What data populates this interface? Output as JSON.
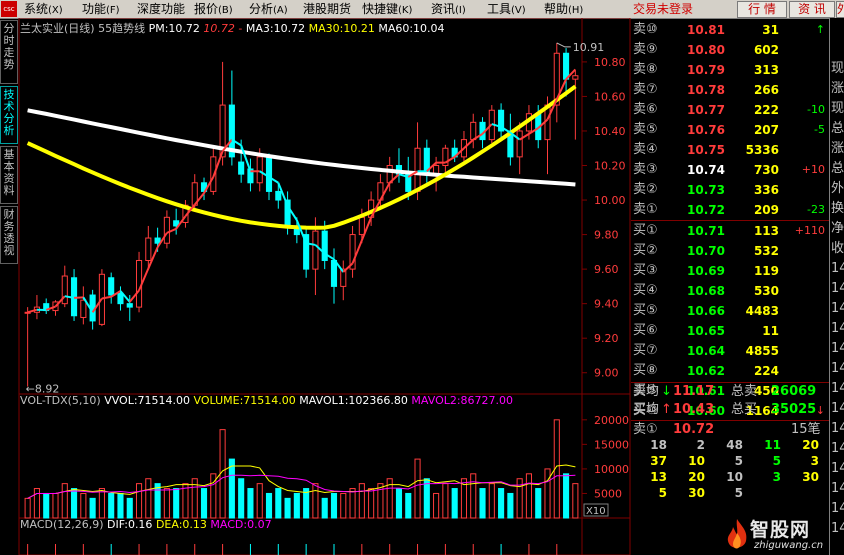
{
  "menu": {
    "items": [
      {
        "label": "系统",
        "key": "(X)"
      },
      {
        "label": "功能",
        "key": "(F)"
      },
      {
        "label": "深度功能",
        "key": ""
      },
      {
        "label": "报价",
        "key": "(B)"
      },
      {
        "label": "分析",
        "key": "(A)"
      },
      {
        "label": "港股期货",
        "key": ""
      },
      {
        "label": "快捷键",
        "key": "(K)"
      },
      {
        "label": "资讯",
        "key": "(I)"
      },
      {
        "label": "工具",
        "key": "(V)"
      },
      {
        "label": "帮助",
        "key": "(H)"
      }
    ],
    "logo": "csc",
    "login_status": "交易未登录",
    "btn_quote": "行 情",
    "btn_news": "资 讯",
    "btn_foreign": "外"
  },
  "side_tabs": [
    "分时走势",
    "技术分析",
    "基本资料",
    "财务透视"
  ],
  "price_header": {
    "title": "兰太实业(日线) 55趋势线",
    "pm_label": "PM:10.72",
    "pm_value": "10.72",
    "pm_dash": "-",
    "ma3": "MA3:10.72",
    "ma30": "MA30:10.21",
    "ma60": "MA60:10.04"
  },
  "price_axis": {
    "labels": [
      "10.80",
      "10.60",
      "10.40",
      "10.20",
      "10.00",
      "9.80",
      "9.60",
      "9.40",
      "9.20",
      "9.00"
    ],
    "high_marker": "10.91",
    "low_marker": "8.92"
  },
  "volume_header": {
    "name": "VOL-TDX(5,10)",
    "vvol": "VVOL:71514.00",
    "volume": "VOLUME:71514.00",
    "mavol1": "MAVOL1:102366.80",
    "mavol2": "MAVOL2:86727.00"
  },
  "volume_axis": {
    "labels": [
      "20000",
      "15000",
      "10000",
      "5000"
    ],
    "unit": "X10"
  },
  "macd_header": {
    "name": "MACD(12,26,9)",
    "dif": "DIF:0.16",
    "dea": "DEA:0.13",
    "macd": "MACD:0.07"
  },
  "order_book": {
    "asks": [
      {
        "label": "卖⑩",
        "price": "10.81",
        "vol": "31",
        "chg": "↑",
        "price_color": "#ff3c3c",
        "chg_color": "#00ff00"
      },
      {
        "label": "卖⑨",
        "price": "10.80",
        "vol": "602",
        "chg": "",
        "price_color": "#ff3c3c",
        "chg_color": "#c0c0c0"
      },
      {
        "label": "卖⑧",
        "price": "10.79",
        "vol": "313",
        "chg": "",
        "price_color": "#ff3c3c",
        "chg_color": "#c0c0c0"
      },
      {
        "label": "卖⑦",
        "price": "10.78",
        "vol": "266",
        "chg": "",
        "price_color": "#ff3c3c",
        "chg_color": "#c0c0c0"
      },
      {
        "label": "卖⑥",
        "price": "10.77",
        "vol": "222",
        "chg": "-10",
        "price_color": "#ff3c3c",
        "chg_color": "#00ff00"
      },
      {
        "label": "卖⑤",
        "price": "10.76",
        "vol": "207",
        "chg": "-5",
        "price_color": "#ff3c3c",
        "chg_color": "#00ff00"
      },
      {
        "label": "卖④",
        "price": "10.75",
        "vol": "5336",
        "chg": "",
        "price_color": "#ff3c3c",
        "chg_color": "#c0c0c0"
      },
      {
        "label": "卖③",
        "price": "10.74",
        "vol": "730",
        "chg": "+10",
        "price_color": "#ffffff",
        "chg_color": "#ff3c3c"
      },
      {
        "label": "卖②",
        "price": "10.73",
        "vol": "336",
        "chg": "",
        "price_color": "#00ff00",
        "chg_color": "#c0c0c0"
      },
      {
        "label": "卖①",
        "price": "10.72",
        "vol": "209",
        "chg": "-23",
        "price_color": "#00ff00",
        "chg_color": "#00ff00"
      }
    ],
    "bids": [
      {
        "label": "买①",
        "price": "10.71",
        "vol": "113",
        "chg": "+110",
        "price_color": "#00ff00",
        "chg_color": "#ff3c3c"
      },
      {
        "label": "买②",
        "price": "10.70",
        "vol": "532",
        "chg": "",
        "price_color": "#00ff00",
        "chg_color": "#c0c0c0"
      },
      {
        "label": "买③",
        "price": "10.69",
        "vol": "119",
        "chg": "",
        "price_color": "#00ff00",
        "chg_color": "#c0c0c0"
      },
      {
        "label": "买④",
        "price": "10.68",
        "vol": "530",
        "chg": "",
        "price_color": "#00ff00",
        "chg_color": "#c0c0c0"
      },
      {
        "label": "买⑤",
        "price": "10.66",
        "vol": "4483",
        "chg": "",
        "price_color": "#00ff00",
        "chg_color": "#c0c0c0"
      },
      {
        "label": "买⑥",
        "price": "10.65",
        "vol": "11",
        "chg": "",
        "price_color": "#00ff00",
        "chg_color": "#c0c0c0"
      },
      {
        "label": "买⑦",
        "price": "10.64",
        "vol": "4855",
        "chg": "",
        "price_color": "#00ff00",
        "chg_color": "#c0c0c0"
      },
      {
        "label": "买⑧",
        "price": "10.62",
        "vol": "224",
        "chg": "",
        "price_color": "#00ff00",
        "chg_color": "#c0c0c0"
      },
      {
        "label": "买⑨",
        "price": "10.61",
        "vol": "450",
        "chg": "",
        "price_color": "#00ff00",
        "chg_color": "#c0c0c0"
      },
      {
        "label": "买⑩",
        "price": "10.60",
        "vol": "1164",
        "chg": "↓",
        "price_color": "#00ff00",
        "chg_color": "#ff3c3c"
      }
    ],
    "avg_sell": {
      "label": "卖均",
      "arrow": "↓",
      "price": "11.17",
      "total_label": "总卖",
      "total": "26069"
    },
    "avg_buy": {
      "label": "买均",
      "arrow": "↑",
      "price": "10.43",
      "total_label": "总买",
      "total": "35025"
    },
    "queue": {
      "label": "卖①",
      "price": "10.72",
      "count": "15笔"
    },
    "queue_rows": [
      [
        "18",
        "2",
        "48",
        "11",
        "20"
      ],
      [
        "37",
        "10",
        "5",
        "5",
        "3"
      ],
      [
        "13",
        "20",
        "10",
        "3",
        "30"
      ],
      [
        "5",
        "30",
        "5",
        "",
        ""
      ]
    ]
  },
  "right_panel": {
    "chars": [
      "现",
      "涨",
      "现",
      "总",
      "涨",
      "总",
      "外",
      "换",
      "净",
      "收",
      "14",
      "14",
      "14",
      "14",
      "14",
      "14",
      "14",
      "14",
      "14",
      "14",
      "14",
      "14",
      "14",
      "14"
    ]
  },
  "watermark": {
    "brand": "智股网",
    "site": "zhiguwang.cn"
  },
  "colors": {
    "up": "#ff3c3c",
    "down": "#00ffff",
    "ma_white": "#ffffff",
    "ma_yellow": "#ffff00",
    "pm_red": "#ff3c3c",
    "grid": "#800000",
    "axis_text": "#ff3c3c",
    "vol_avg1": "#ffff00",
    "vol_avg2": "#ff00ff"
  },
  "chart_data": [
    {
      "type": "candlestick",
      "title": "兰太实业(日线) 55趋势线",
      "ylim": [
        8.9,
        10.95
      ],
      "candles": [
        [
          9.35,
          9.38,
          8.92,
          9.35
        ],
        [
          9.35,
          9.45,
          9.31,
          9.38
        ],
        [
          9.4,
          9.43,
          9.34,
          9.36
        ],
        [
          9.36,
          9.42,
          9.33,
          9.41
        ],
        [
          9.4,
          9.62,
          9.38,
          9.56
        ],
        [
          9.55,
          9.6,
          9.3,
          9.33
        ],
        [
          9.32,
          9.5,
          9.28,
          9.42
        ],
        [
          9.45,
          9.48,
          9.25,
          9.3
        ],
        [
          9.28,
          9.6,
          9.27,
          9.57
        ],
        [
          9.55,
          9.58,
          9.4,
          9.45
        ],
        [
          9.46,
          9.5,
          9.36,
          9.4
        ],
        [
          9.4,
          9.45,
          9.3,
          9.38
        ],
        [
          9.38,
          9.7,
          9.35,
          9.65
        ],
        [
          9.65,
          9.85,
          9.6,
          9.78
        ],
        [
          9.78,
          9.84,
          9.7,
          9.75
        ],
        [
          9.75,
          9.94,
          9.72,
          9.9
        ],
        [
          9.88,
          9.95,
          9.8,
          9.85
        ],
        [
          9.87,
          10.0,
          9.84,
          9.97
        ],
        [
          9.97,
          10.15,
          9.94,
          10.1
        ],
        [
          10.1,
          10.13,
          10.0,
          10.05
        ],
        [
          10.05,
          10.3,
          10.03,
          10.25
        ],
        [
          10.25,
          10.8,
          10.2,
          10.55
        ],
        [
          10.55,
          10.75,
          10.2,
          10.25
        ],
        [
          10.22,
          10.35,
          10.1,
          10.15
        ],
        [
          10.18,
          10.24,
          10.05,
          10.1
        ],
        [
          10.1,
          10.3,
          10.05,
          10.25
        ],
        [
          10.25,
          10.27,
          10.0,
          10.05
        ],
        [
          10.05,
          10.1,
          9.95,
          10.0
        ],
        [
          10.0,
          10.05,
          9.8,
          9.85
        ],
        [
          9.85,
          9.9,
          9.75,
          9.8
        ],
        [
          9.8,
          9.85,
          9.55,
          9.6
        ],
        [
          9.6,
          9.9,
          9.45,
          9.82
        ],
        [
          9.82,
          9.88,
          9.6,
          9.65
        ],
        [
          9.65,
          9.72,
          9.4,
          9.5
        ],
        [
          9.5,
          9.65,
          9.42,
          9.6
        ],
        [
          9.6,
          9.85,
          9.55,
          9.8
        ],
        [
          9.8,
          9.95,
          9.75,
          9.9
        ],
        [
          9.9,
          10.05,
          9.85,
          10.0
        ],
        [
          10.0,
          10.15,
          9.95,
          10.1
        ],
        [
          10.1,
          10.25,
          10.05,
          10.2
        ],
        [
          10.2,
          10.3,
          10.1,
          10.15
        ],
        [
          10.15,
          10.25,
          10.0,
          10.05
        ],
        [
          10.05,
          10.45,
          10.0,
          10.3
        ],
        [
          10.3,
          10.35,
          10.1,
          10.15
        ],
        [
          10.15,
          10.25,
          10.05,
          10.2
        ],
        [
          10.2,
          10.32,
          10.15,
          10.3
        ],
        [
          10.3,
          10.35,
          10.22,
          10.25
        ],
        [
          10.25,
          10.4,
          10.2,
          10.35
        ],
        [
          10.35,
          10.5,
          10.3,
          10.45
        ],
        [
          10.45,
          10.48,
          10.3,
          10.35
        ],
        [
          10.35,
          10.55,
          10.33,
          10.52
        ],
        [
          10.52,
          10.56,
          10.35,
          10.4
        ],
        [
          10.4,
          10.5,
          10.2,
          10.25
        ],
        [
          10.25,
          10.45,
          10.15,
          10.4
        ],
        [
          10.4,
          10.55,
          10.35,
          10.5
        ],
        [
          10.5,
          10.55,
          10.3,
          10.35
        ],
        [
          10.35,
          10.6,
          10.15,
          10.55
        ],
        [
          10.55,
          10.91,
          10.45,
          10.85
        ],
        [
          10.85,
          10.88,
          10.6,
          10.7
        ],
        [
          10.7,
          10.75,
          10.35,
          10.72
        ]
      ],
      "volumes": [
        4,
        6,
        5,
        5,
        7,
        6,
        5,
        4,
        6,
        5,
        5,
        4,
        7,
        8,
        7,
        6,
        6,
        7,
        8,
        6,
        9,
        18,
        12,
        8,
        6,
        7,
        5,
        6,
        4,
        5,
        6,
        7,
        4,
        5,
        5,
        6,
        7,
        6,
        7,
        8,
        6,
        5,
        12,
        8,
        5,
        7,
        6,
        8,
        9,
        6,
        7,
        6,
        5,
        8,
        9,
        6,
        10,
        20,
        9,
        7
      ]
    }
  ]
}
